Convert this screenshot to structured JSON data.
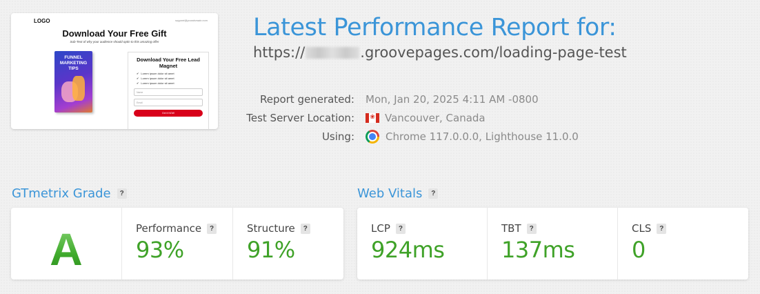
{
  "thumbnail": {
    "logo": "LOGO",
    "email": "support@yourdomain.com",
    "title": "Download Your Free Gift",
    "subtitle": "Sub-Text of why your audience should optin to this amazing offer",
    "book_title": "FUNNEL MARKETING TIPS",
    "form_title": "Download Your Free Lead Magnet",
    "bullets": [
      "Lorem ipsum dolor sit amet",
      "Lorem ipsum dolor sit amet",
      "Lorem ipsum dolor sit amet"
    ],
    "name_placeholder": "Name",
    "email_placeholder": "Email",
    "button": "Get it NOW"
  },
  "report": {
    "title": "Latest Performance Report for:",
    "url_prefix": "https://",
    "url_suffix": ".groovepages.com/loading-page-test",
    "rows": [
      {
        "label": "Report generated:",
        "value": "Mon, Jan 20, 2025 4:11 AM -0800"
      },
      {
        "label": "Test Server Location:",
        "value": "Vancouver, Canada",
        "icon": "canada-flag-icon"
      },
      {
        "label": "Using:",
        "value": "Chrome 117.0.0.0, Lighthouse 11.0.0",
        "icon": "chrome-icon"
      }
    ]
  },
  "grade_section": {
    "title": "GTmetrix Grade",
    "help": "?",
    "grade": "A",
    "performance_label": "Performance",
    "performance_value": "93%",
    "structure_label": "Structure",
    "structure_value": "91%"
  },
  "vitals_section": {
    "title": "Web Vitals",
    "help": "?",
    "lcp_label": "LCP",
    "lcp_value": "924ms",
    "tbt_label": "TBT",
    "tbt_value": "137ms",
    "cls_label": "CLS",
    "cls_value": "0"
  },
  "colors": {
    "accent": "#3b95d8",
    "good": "#3fa228"
  }
}
